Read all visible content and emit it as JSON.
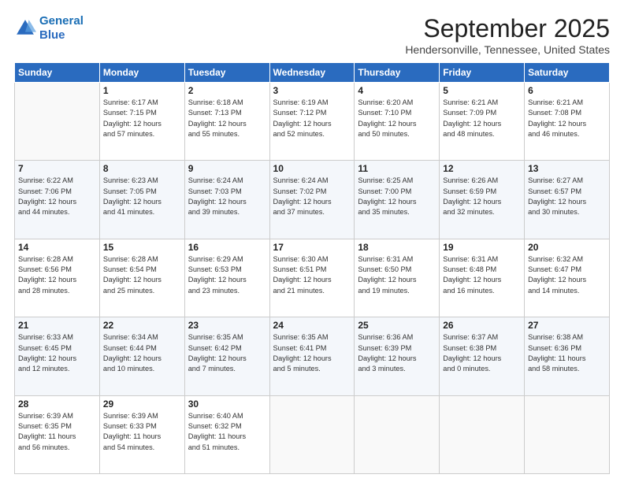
{
  "logo": {
    "line1": "General",
    "line2": "Blue"
  },
  "title": "September 2025",
  "location": "Hendersonville, Tennessee, United States",
  "days_header": [
    "Sunday",
    "Monday",
    "Tuesday",
    "Wednesday",
    "Thursday",
    "Friday",
    "Saturday"
  ],
  "weeks": [
    [
      {
        "num": "",
        "info": ""
      },
      {
        "num": "1",
        "info": "Sunrise: 6:17 AM\nSunset: 7:15 PM\nDaylight: 12 hours\nand 57 minutes."
      },
      {
        "num": "2",
        "info": "Sunrise: 6:18 AM\nSunset: 7:13 PM\nDaylight: 12 hours\nand 55 minutes."
      },
      {
        "num": "3",
        "info": "Sunrise: 6:19 AM\nSunset: 7:12 PM\nDaylight: 12 hours\nand 52 minutes."
      },
      {
        "num": "4",
        "info": "Sunrise: 6:20 AM\nSunset: 7:10 PM\nDaylight: 12 hours\nand 50 minutes."
      },
      {
        "num": "5",
        "info": "Sunrise: 6:21 AM\nSunset: 7:09 PM\nDaylight: 12 hours\nand 48 minutes."
      },
      {
        "num": "6",
        "info": "Sunrise: 6:21 AM\nSunset: 7:08 PM\nDaylight: 12 hours\nand 46 minutes."
      }
    ],
    [
      {
        "num": "7",
        "info": "Sunrise: 6:22 AM\nSunset: 7:06 PM\nDaylight: 12 hours\nand 44 minutes."
      },
      {
        "num": "8",
        "info": "Sunrise: 6:23 AM\nSunset: 7:05 PM\nDaylight: 12 hours\nand 41 minutes."
      },
      {
        "num": "9",
        "info": "Sunrise: 6:24 AM\nSunset: 7:03 PM\nDaylight: 12 hours\nand 39 minutes."
      },
      {
        "num": "10",
        "info": "Sunrise: 6:24 AM\nSunset: 7:02 PM\nDaylight: 12 hours\nand 37 minutes."
      },
      {
        "num": "11",
        "info": "Sunrise: 6:25 AM\nSunset: 7:00 PM\nDaylight: 12 hours\nand 35 minutes."
      },
      {
        "num": "12",
        "info": "Sunrise: 6:26 AM\nSunset: 6:59 PM\nDaylight: 12 hours\nand 32 minutes."
      },
      {
        "num": "13",
        "info": "Sunrise: 6:27 AM\nSunset: 6:57 PM\nDaylight: 12 hours\nand 30 minutes."
      }
    ],
    [
      {
        "num": "14",
        "info": "Sunrise: 6:28 AM\nSunset: 6:56 PM\nDaylight: 12 hours\nand 28 minutes."
      },
      {
        "num": "15",
        "info": "Sunrise: 6:28 AM\nSunset: 6:54 PM\nDaylight: 12 hours\nand 25 minutes."
      },
      {
        "num": "16",
        "info": "Sunrise: 6:29 AM\nSunset: 6:53 PM\nDaylight: 12 hours\nand 23 minutes."
      },
      {
        "num": "17",
        "info": "Sunrise: 6:30 AM\nSunset: 6:51 PM\nDaylight: 12 hours\nand 21 minutes."
      },
      {
        "num": "18",
        "info": "Sunrise: 6:31 AM\nSunset: 6:50 PM\nDaylight: 12 hours\nand 19 minutes."
      },
      {
        "num": "19",
        "info": "Sunrise: 6:31 AM\nSunset: 6:48 PM\nDaylight: 12 hours\nand 16 minutes."
      },
      {
        "num": "20",
        "info": "Sunrise: 6:32 AM\nSunset: 6:47 PM\nDaylight: 12 hours\nand 14 minutes."
      }
    ],
    [
      {
        "num": "21",
        "info": "Sunrise: 6:33 AM\nSunset: 6:45 PM\nDaylight: 12 hours\nand 12 minutes."
      },
      {
        "num": "22",
        "info": "Sunrise: 6:34 AM\nSunset: 6:44 PM\nDaylight: 12 hours\nand 10 minutes."
      },
      {
        "num": "23",
        "info": "Sunrise: 6:35 AM\nSunset: 6:42 PM\nDaylight: 12 hours\nand 7 minutes."
      },
      {
        "num": "24",
        "info": "Sunrise: 6:35 AM\nSunset: 6:41 PM\nDaylight: 12 hours\nand 5 minutes."
      },
      {
        "num": "25",
        "info": "Sunrise: 6:36 AM\nSunset: 6:39 PM\nDaylight: 12 hours\nand 3 minutes."
      },
      {
        "num": "26",
        "info": "Sunrise: 6:37 AM\nSunset: 6:38 PM\nDaylight: 12 hours\nand 0 minutes."
      },
      {
        "num": "27",
        "info": "Sunrise: 6:38 AM\nSunset: 6:36 PM\nDaylight: 11 hours\nand 58 minutes."
      }
    ],
    [
      {
        "num": "28",
        "info": "Sunrise: 6:39 AM\nSunset: 6:35 PM\nDaylight: 11 hours\nand 56 minutes."
      },
      {
        "num": "29",
        "info": "Sunrise: 6:39 AM\nSunset: 6:33 PM\nDaylight: 11 hours\nand 54 minutes."
      },
      {
        "num": "30",
        "info": "Sunrise: 6:40 AM\nSunset: 6:32 PM\nDaylight: 11 hours\nand 51 minutes."
      },
      {
        "num": "",
        "info": ""
      },
      {
        "num": "",
        "info": ""
      },
      {
        "num": "",
        "info": ""
      },
      {
        "num": "",
        "info": ""
      }
    ]
  ]
}
